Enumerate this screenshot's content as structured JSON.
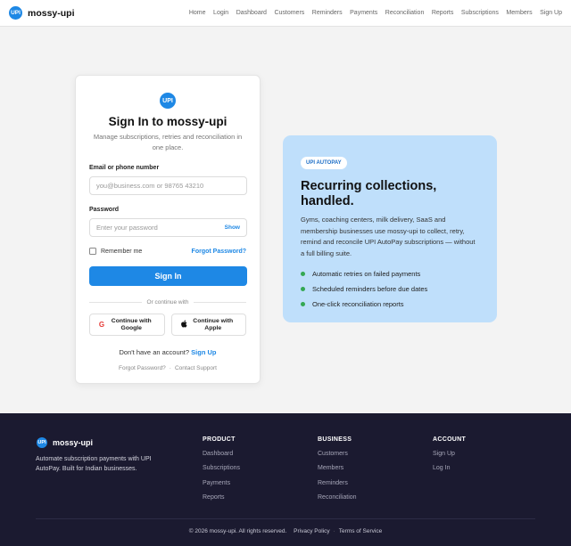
{
  "header": {
    "logo_text": "UPI",
    "brand": "mossy-upi",
    "nav": [
      "Home",
      "Login",
      "Dashboard",
      "Customers",
      "Reminders",
      "Payments",
      "Reconciliation",
      "Reports",
      "Subscriptions",
      "Members",
      "Sign Up"
    ]
  },
  "card": {
    "logo_text": "UPI",
    "title": "Sign In to mossy-upi",
    "subtitle": "Manage subscriptions, retries and reconciliation in one place.",
    "email_label": "Email or phone number",
    "email_placeholder": "you@business.com or 98765 43210",
    "password_label": "Password",
    "password_placeholder": "Enter your password",
    "show_label": "Show",
    "remember_label": "Remember me",
    "forgot_label": "Forgot Password?",
    "signin_label": "Sign In",
    "divider_text": "Or continue with",
    "google_label": "Continue with Google",
    "apple_label": "Continue with Apple",
    "no_account_text": "Don't have an account?",
    "signup_link": "Sign Up",
    "bottom_forgot": "Forgot Password?",
    "bottom_dot": "·",
    "contact_support": "Contact Support"
  },
  "promo": {
    "pill": "UPI AUTOPAY",
    "title": "Recurring collections, handled.",
    "description": "Gyms, coaching centers, milk delivery, SaaS and membership businesses use mossy-upi to collect, retry, remind and reconcile UPI AutoPay subscriptions — without a full billing suite.",
    "bullets": [
      "Automatic retries on failed payments",
      "Scheduled reminders before due dates",
      "One-click reconciliation reports"
    ],
    "bullet_color": "#34a853"
  },
  "footer": {
    "logo_text": "UPI",
    "brand": "mossy-upi",
    "tagline": "Automate subscription payments with UPI AutoPay. Built for Indian businesses.",
    "columns": [
      {
        "title": "PRODUCT",
        "links": [
          "Dashboard",
          "Subscriptions",
          "Payments",
          "Reports"
        ]
      },
      {
        "title": "BUSINESS",
        "links": [
          "Customers",
          "Members",
          "Reminders",
          "Reconciliation"
        ]
      },
      {
        "title": "ACCOUNT",
        "links": [
          "Sign Up",
          "Log In"
        ]
      }
    ],
    "copyright": "© 2026 mossy-upi. All rights reserved.",
    "privacy": "Privacy Policy",
    "sep": "·",
    "terms": "Terms of Service"
  },
  "colors": {
    "accent": "#1e88e5",
    "promo_bg": "#bfdffb",
    "footer_bg": "#1b1a30"
  }
}
